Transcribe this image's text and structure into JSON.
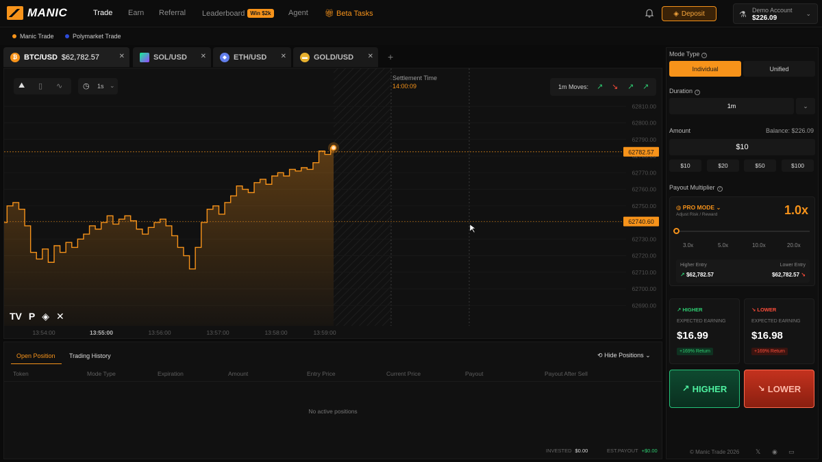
{
  "nav": {
    "logo": "MANIC",
    "items": [
      "Trade",
      "Earn",
      "Referral",
      "Leaderboard",
      "Agent",
      "Beta Tasks"
    ],
    "leaderboard_badge": "Win $2k",
    "deposit": "Deposit",
    "account_label": "Demo Account",
    "account_balance": "$226.09"
  },
  "subnav": {
    "items": [
      {
        "label": "Manic Trade",
        "color": "#f7931a"
      },
      {
        "label": "Polymarket Trade",
        "color": "#2d4bd8"
      }
    ]
  },
  "pairs": [
    {
      "label": "BTC/USD",
      "price": "$62,782.57",
      "icon": "btc-icon",
      "color": "#f7931a"
    },
    {
      "label": "SOL/USD",
      "price": "",
      "icon": "sol-icon",
      "color": "#9945ff"
    },
    {
      "label": "ETH/USD",
      "price": "",
      "icon": "eth-icon",
      "color": "#627eea"
    },
    {
      "label": "GOLD/USD",
      "price": "",
      "icon": "gold-icon",
      "color": "#e6b02e"
    }
  ],
  "chart": {
    "interval": "1s",
    "moves_label": "1m Moves:",
    "moves": [
      "up",
      "down",
      "up",
      "up"
    ],
    "settlement_label": "Settlement Time",
    "settlement_time": "14:00:09",
    "brand_icons": [
      "TV",
      "P",
      "◈",
      "✕"
    ]
  },
  "chart_data": {
    "type": "line",
    "yticks": [
      "62810.00",
      "62800.00",
      "62790.00",
      "62780.00",
      "62770.00",
      "62760.00",
      "62750.00",
      "62740.00",
      "62730.00",
      "62720.00",
      "62710.00",
      "62700.00",
      "62690.00"
    ],
    "xticks": [
      "13:54:00",
      "13:55:00",
      "13:56:00",
      "13:57:00",
      "13:58:00",
      "13:59:00"
    ],
    "current_price": "62782.57",
    "reference_price": "62740.60",
    "ylim": [
      62686,
      62813
    ],
    "series": [
      {
        "values": [
          62740,
          62750,
          62752,
          62748,
          62738,
          62722,
          62718,
          62724,
          62716,
          62726,
          62722,
          62728,
          62725,
          62730,
          62733,
          62738,
          62736,
          62740,
          62744,
          62739,
          62742,
          62744,
          62741,
          62736,
          62733,
          62737,
          62740,
          62742,
          62738,
          62732,
          62725,
          62720,
          62712,
          62725,
          62740,
          62748,
          62750,
          62745,
          62752,
          62756,
          62762,
          62760,
          62758,
          62764,
          62766,
          62763,
          62768,
          62770,
          62768,
          62772,
          62771,
          62773,
          62772,
          62776,
          62783,
          62781,
          62785
        ]
      }
    ]
  },
  "positions": {
    "tabs": [
      "Open Position",
      "Trading History"
    ],
    "hide_label": "Hide Positions",
    "columns": [
      "Token",
      "Mode Type",
      "Expiration",
      "Amount",
      "Entry Price",
      "Current Price",
      "Payout",
      "Payout After Sell"
    ],
    "empty": "No active positions",
    "invested_label": "INVESTED",
    "invested": "$0.00",
    "payout_label": "EST.PAYOUT",
    "payout": "+$0.00"
  },
  "panel": {
    "mode_label": "Mode Type",
    "modes": [
      "Individual",
      "Unified"
    ],
    "duration_label": "Duration",
    "duration": "1m",
    "amount_label": "Amount",
    "balance": "Balance: $226.09",
    "amount": "$10",
    "quick": [
      "$10",
      "$20",
      "$50",
      "$100"
    ],
    "payout_label": "Payout Multiplier",
    "pro_mode": "PRO MODE",
    "pro_sub": "Adjust Risk / Reward",
    "multiplier": "1.0x",
    "ticks": [
      "3.0x",
      "5.0x",
      "10.0x",
      "20.0x"
    ],
    "higher_entry_label": "Higher Entry",
    "higher_entry": "$62,782.57",
    "lower_entry_label": "Lower Entry",
    "lower_entry": "$62,782.57",
    "higher": {
      "title": "HIGHER",
      "exp": "EXPECTED EARNING",
      "amount": "$16.99",
      "ret": "+169% Return"
    },
    "lower": {
      "title": "LOWER",
      "exp": "EXPECTED EARNING",
      "amount": "$16.98",
      "ret": "+169% Return"
    },
    "higher_btn": "HIGHER",
    "lower_btn": "LOWER",
    "copyright": "© Manic Trade 2026"
  },
  "colors": {
    "accent": "#f7931a",
    "up": "#2ecc71",
    "down": "#ff4d3a"
  }
}
